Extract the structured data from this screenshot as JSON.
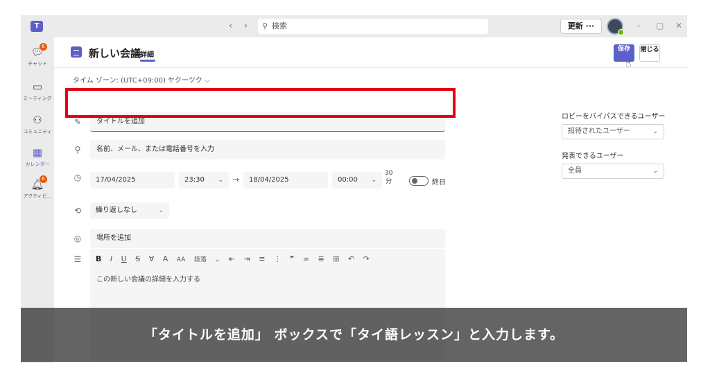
{
  "titlebar": {
    "search_placeholder": "検索",
    "update_label": "更新 ···",
    "minimize": "–",
    "maximize": "▢",
    "close": "✕"
  },
  "rail": {
    "items": [
      {
        "label": "チャット",
        "badge": "6"
      },
      {
        "label": "ミーティング"
      },
      {
        "label": "コミュニティ"
      },
      {
        "label": "カレンダー"
      },
      {
        "label": "アクティビ...",
        "badge": "6"
      }
    ]
  },
  "header": {
    "title": "新しい会議",
    "tab": "詳細",
    "save_label": "保存",
    "close_label": "閉じる"
  },
  "form": {
    "timezone": "タイム ゾーン: (UTC+09:00) ヤクーツク",
    "title_placeholder": "タイトルを追加",
    "attendees_placeholder": "名前、メール、または電話番号を入力",
    "start_date": "17/04/2025",
    "start_time": "23:30",
    "end_date": "18/04/2025",
    "end_time": "00:00",
    "duration_value": "30",
    "duration_unit": "分",
    "all_day_label": "終日",
    "repeat": "繰り返しなし",
    "location_placeholder": "場所を追加",
    "editor_placeholder": "この新しい会議の詳細を入力する",
    "toolbar_paragraph": "段落"
  },
  "side": {
    "lobby_label": "ロビーをバイパスできるユーザー",
    "lobby_value": "招待されたユーザー",
    "presenter_label": "発表できるユーザー",
    "presenter_value": "全員"
  },
  "caption": "「タイトルを追加」 ボックスで「タイ語レッスン」と入力します。",
  "colors": {
    "accent": "#5b5fc7",
    "highlight_box": "#e20014",
    "badge": "#e8590c"
  }
}
